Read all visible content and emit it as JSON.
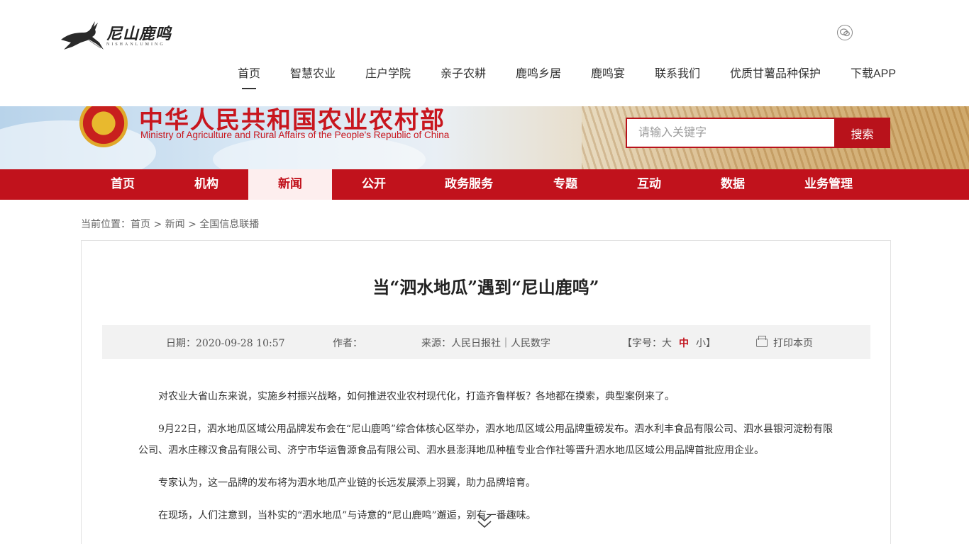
{
  "site": {
    "logo_text": "尼山鹿鸣",
    "logo_sub": "NISHANLUMING"
  },
  "topnav": [
    {
      "label": "首页"
    },
    {
      "label": "智慧农业"
    },
    {
      "label": "庄户学院"
    },
    {
      "label": "亲子农耕"
    },
    {
      "label": "鹿鸣乡居"
    },
    {
      "label": "鹿鸣宴"
    },
    {
      "label": "联系我们"
    },
    {
      "label": "优质甘薯品种保护"
    },
    {
      "label": "下载APP"
    }
  ],
  "banner": {
    "title_cn": "中华人民共和国农业农村部",
    "title_en": "Ministry of Agriculture and Rural Affairs of the People's Republic of China",
    "search_placeholder": "请输入关键字",
    "search_button": "搜索"
  },
  "rednav": [
    {
      "label": "首页"
    },
    {
      "label": "机构"
    },
    {
      "label": "新闻"
    },
    {
      "label": "公开"
    },
    {
      "label": "政务服务"
    },
    {
      "label": "专题"
    },
    {
      "label": "互动"
    },
    {
      "label": "数据"
    },
    {
      "label": "业务管理"
    }
  ],
  "breadcrumb": {
    "prefix": "当前位置：",
    "items": [
      "首页",
      "新闻",
      "全国信息联播"
    ],
    "sep": " > "
  },
  "article": {
    "title": "当“泗水地瓜”遇到“尼山鹿鸣”",
    "meta": {
      "date": "日期：2020-09-28 10:57",
      "author": "作者：",
      "source": "来源：人民日报社｜人民数字",
      "font_label_open": "【字号：",
      "size_large": "大",
      "size_medium": "中",
      "size_small": "小",
      "font_label_close": "】",
      "print": "打印本页"
    },
    "paragraphs": [
      "对农业大省山东来说，实施乡村振兴战略，如何推进农业农村现代化，打造齐鲁样板？各地都在摸索，典型案例来了。",
      "9月22日，泗水地瓜区域公用品牌发布会在“尼山鹿鸣”综合体核心区举办，泗水地瓜区域公用品牌重磅发布。泗水利丰食品有限公司、泗水县银河淀粉有限公司、泗水庄稼汉食品有限公司、济宁市华运鲁源食品有限公司、泗水县澎湃地瓜种植专业合作社等晋升泗水地瓜区域公用品牌首批应用企业。",
      "专家认为，这一品牌的发布将为泗水地瓜产业链的长远发展添上羽翼，助力品牌培育。",
      "在现场，人们注意到，当朴实的“泗水地瓜”与诗意的“尼山鹿鸣”邂逅，别有一番趣味。"
    ]
  },
  "colors": {
    "brand_red": "#c1121c",
    "search_red": "#b8121b"
  }
}
